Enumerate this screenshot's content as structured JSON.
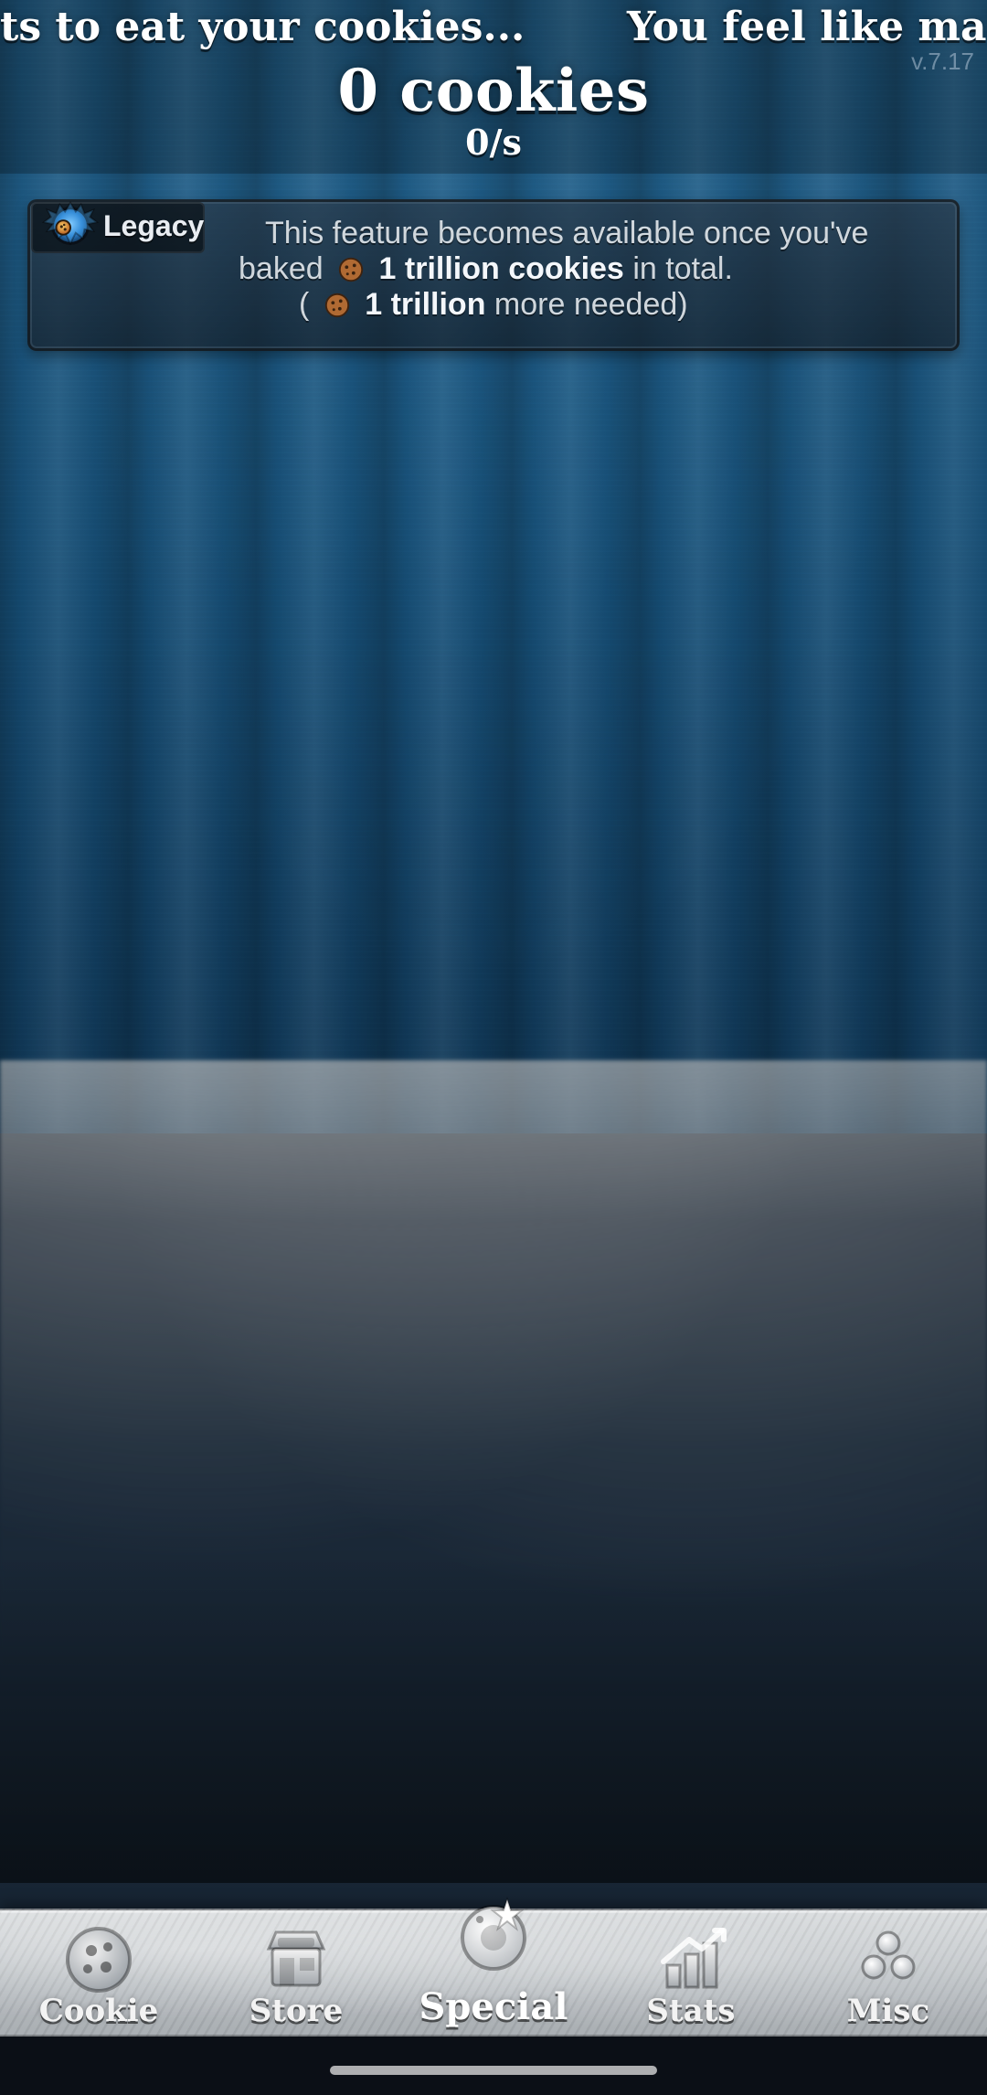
{
  "ticker": {
    "left": "ts to eat your cookies...",
    "right": "You feel like mak"
  },
  "version": "v.7.17",
  "header": {
    "cookies": "0 cookies",
    "cps": "0/s"
  },
  "legacy": {
    "tab_label": "Legacy",
    "line1": "This feature becomes available once you've",
    "line2_prefix": "baked",
    "line2_bold": "1 trillion cookies",
    "line2_suffix": "in total.",
    "line3_open": "(",
    "line3_bold": "1 trillion",
    "line3_suffix": "more needed)"
  },
  "nav": {
    "items": [
      {
        "label": "Cookie",
        "icon": "cookie-icon"
      },
      {
        "label": "Store",
        "icon": "shop-icon"
      },
      {
        "label": "Special",
        "icon": "special-icon",
        "active": true
      },
      {
        "label": "Stats",
        "icon": "stats-icon"
      },
      {
        "label": "Misc",
        "icon": "misc-icon"
      }
    ]
  }
}
